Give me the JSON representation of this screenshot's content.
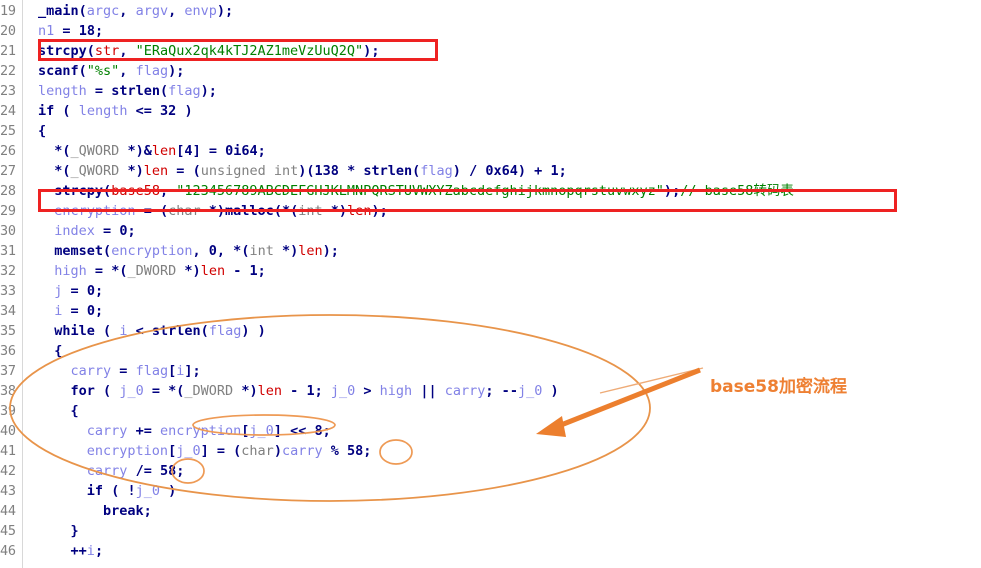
{
  "view": {
    "kind": "decompiler-pseudocode",
    "first_line": 19,
    "last_line": 46
  },
  "colors": {
    "keyword": "#000080",
    "variable": "#8282e6",
    "string": "#008000",
    "comment": "#008000",
    "type": "#808080",
    "global": "#d00000",
    "line_number": "#808080",
    "red_box": "#ee2222",
    "orange_annotation": "#ee8033",
    "background": "#ffffff"
  },
  "code": {
    "lines": [
      {
        "n": "19",
        "text": "_main(argc, argv, envp);"
      },
      {
        "n": "20",
        "text": "n1 = 18;"
      },
      {
        "n": "21",
        "text": "strcpy(str, \"ERaQux2qk4kTJ2AZ1meVzUuQ2Q\");"
      },
      {
        "n": "22",
        "text": "scanf(\"%s\", flag);"
      },
      {
        "n": "23",
        "text": "length = strlen(flag);"
      },
      {
        "n": "24",
        "text": "if ( length <= 32 )"
      },
      {
        "n": "25",
        "text": "{"
      },
      {
        "n": "26",
        "text": "  *(_QWORD *)&len[4] = 0i64;"
      },
      {
        "n": "27",
        "text": "  *(_QWORD *)len = (unsigned int)(138 * strlen(flag) / 0x64) + 1;"
      },
      {
        "n": "28",
        "text": "  strcpy(base58, \"123456789ABCDEFGHJKLMNPQRSTUVWXYZabcdefghijkmnopqrstuvwxyz\");// base58转码表"
      },
      {
        "n": "29",
        "text": "  encryption = (char *)malloc(*(int *)len);"
      },
      {
        "n": "30",
        "text": "  index = 0;"
      },
      {
        "n": "31",
        "text": "  memset(encryption, 0, *(int *)len);"
      },
      {
        "n": "32",
        "text": "  high = *(_DWORD *)len - 1;"
      },
      {
        "n": "33",
        "text": "  j = 0;"
      },
      {
        "n": "34",
        "text": "  i = 0;"
      },
      {
        "n": "35",
        "text": "  while ( i < strlen(flag) )"
      },
      {
        "n": "36",
        "text": "  {"
      },
      {
        "n": "37",
        "text": "    carry = flag[i];"
      },
      {
        "n": "38",
        "text": "    for ( j_0 = *(_DWORD *)len - 1; j_0 > high || carry; --j_0 )"
      },
      {
        "n": "39",
        "text": "    {"
      },
      {
        "n": "40",
        "text": "      carry += encryption[j_0] << 8;"
      },
      {
        "n": "41",
        "text": "      encryption[j_0] = (char)carry % 58;"
      },
      {
        "n": "42",
        "text": "      carry /= 58;"
      },
      {
        "n": "43",
        "text": "      if ( !j_0 )"
      },
      {
        "n": "44",
        "text": "        break;"
      },
      {
        "n": "45",
        "text": "    }"
      },
      {
        "n": "46",
        "text": "    ++i;"
      }
    ],
    "string_literals": [
      "ERaQux2qk4kTJ2AZ1meVzUuQ2Q",
      "%s",
      "123456789ABCDEFGHJKLMNPQRSTUVWXYZabcdefghijkmnopqrstuvwxyz"
    ],
    "comments": [
      "// base58转码表"
    ]
  },
  "annotations": {
    "label": "base58加密流程",
    "red_boxes": [
      {
        "target_line": "21",
        "note": "strcpy(str, \"ERaQux2qk4kTJ2AZ1meVzUuQ2Q\");"
      },
      {
        "target_line": "28",
        "note": "strcpy(base58, base58 alphabet);// base58转码表"
      }
    ],
    "circled_tokens": [
      "encryption[j_0] << 8",
      "58",
      "58"
    ],
    "big_ellipse_lines": [
      "35",
      "36",
      "37",
      "38",
      "39",
      "40",
      "41",
      "42",
      "43",
      "44"
    ]
  }
}
